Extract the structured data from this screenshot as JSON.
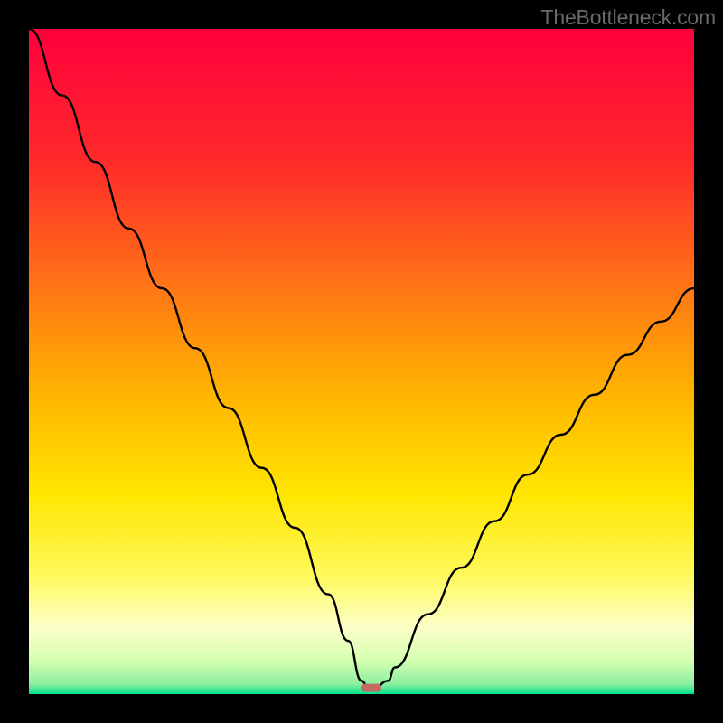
{
  "watermark": "TheBottleneck.com",
  "chart_data": {
    "type": "line",
    "title": "",
    "xlabel": "",
    "ylabel": "",
    "xlim": [
      0,
      100
    ],
    "ylim": [
      0,
      100
    ],
    "x": [
      0,
      5,
      10,
      15,
      20,
      25,
      30,
      35,
      40,
      45,
      48,
      50,
      51,
      52,
      54,
      55,
      60,
      65,
      70,
      75,
      80,
      85,
      90,
      95,
      100
    ],
    "values": [
      100,
      90,
      80,
      70,
      61,
      52,
      43,
      34,
      25,
      15,
      8,
      2,
      1,
      1,
      2,
      4,
      12,
      19,
      26,
      33,
      39,
      45,
      51,
      56,
      61
    ],
    "marker": {
      "x": 51.5,
      "y": 1.0,
      "color": "#c56a63"
    },
    "gradient_stops": [
      {
        "offset": 0,
        "color": "#ff003c"
      },
      {
        "offset": 0.2,
        "color": "#ff2a2a"
      },
      {
        "offset": 0.4,
        "color": "#ff7a14"
      },
      {
        "offset": 0.55,
        "color": "#ffb400"
      },
      {
        "offset": 0.7,
        "color": "#ffe600"
      },
      {
        "offset": 0.82,
        "color": "#fff95a"
      },
      {
        "offset": 0.9,
        "color": "#fcffc8"
      },
      {
        "offset": 0.95,
        "color": "#d4ffb0"
      },
      {
        "offset": 0.985,
        "color": "#8cf0a0"
      },
      {
        "offset": 1.0,
        "color": "#00e28a"
      }
    ]
  }
}
